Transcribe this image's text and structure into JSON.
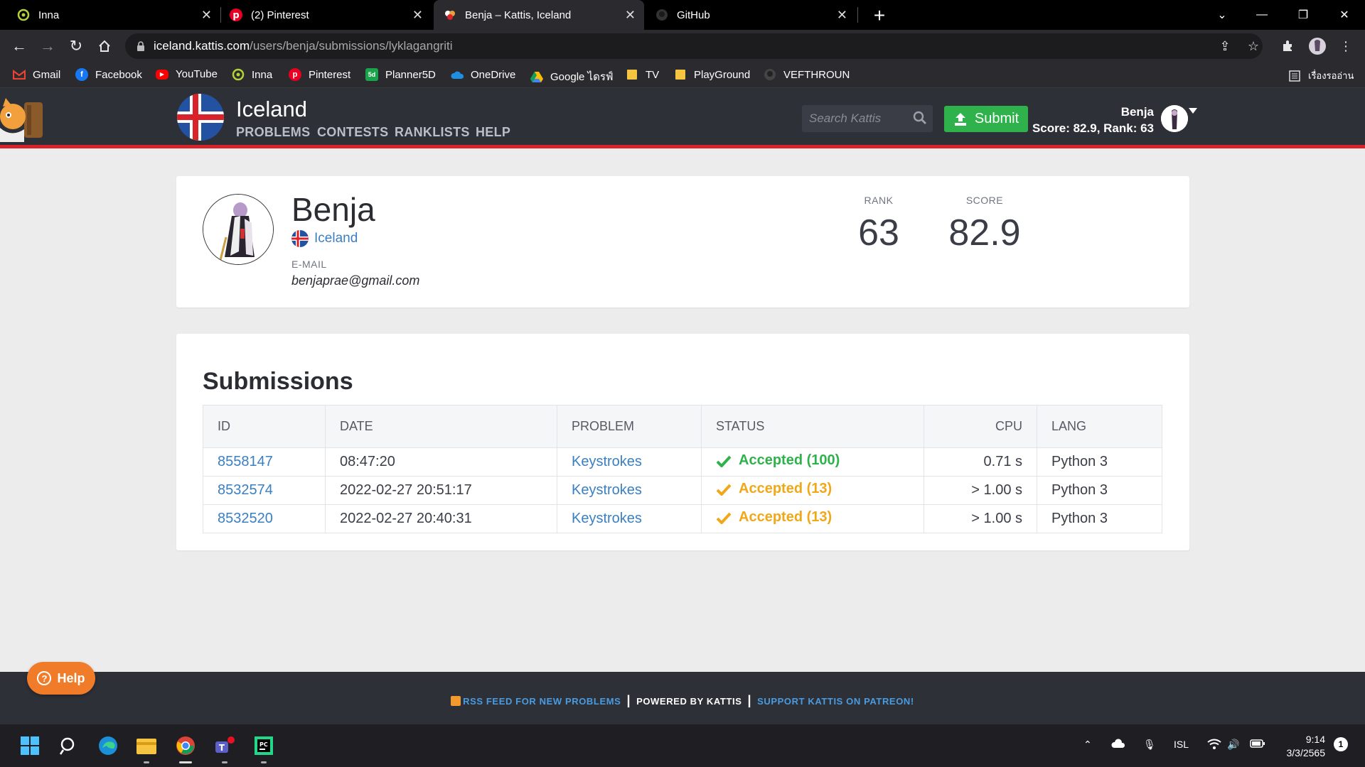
{
  "browser": {
    "tabs": [
      {
        "title": "Inna",
        "icon": "inna-icon"
      },
      {
        "title": "(2) Pinterest",
        "icon": "pinterest-icon"
      },
      {
        "title": "Benja – Kattis, Iceland",
        "icon": "kattis-icon"
      },
      {
        "title": "GitHub",
        "icon": "github-icon"
      }
    ],
    "url_host": "iceland.kattis.com",
    "url_path": "/users/benja/submissions/lyklagangriti",
    "bookmarks": [
      {
        "label": "Gmail"
      },
      {
        "label": "Facebook"
      },
      {
        "label": "YouTube"
      },
      {
        "label": "Inna"
      },
      {
        "label": "Pinterest"
      },
      {
        "label": "Planner5D"
      },
      {
        "label": "OneDrive"
      },
      {
        "label": "Google ไดรฟ์"
      },
      {
        "label": "TV"
      },
      {
        "label": "PlayGround"
      },
      {
        "label": "VEFTHROUN"
      }
    ],
    "reading_list": "เรื่องรออ่าน"
  },
  "header": {
    "brand": "Iceland",
    "nav": [
      "PROBLEMS",
      "CONTESTS",
      "RANKLISTS",
      "HELP"
    ],
    "search_placeholder": "Search Kattis",
    "submit_label": "Submit",
    "user_name": "Benja",
    "user_stats": "Score: 82.9, Rank: 63"
  },
  "profile": {
    "name": "Benja",
    "country": "Iceland",
    "email_label": "E-MAIL",
    "email": "benjaprae@gmail.com",
    "rank_label": "RANK",
    "rank": "63",
    "score_label": "SCORE",
    "score": "82.9"
  },
  "submissions": {
    "title": "Submissions",
    "columns": [
      "ID",
      "DATE",
      "PROBLEM",
      "STATUS",
      "CPU",
      "LANG"
    ],
    "rows": [
      {
        "id": "8558147",
        "date": "08:47:20",
        "problem": "Keystrokes",
        "status": "Accepted (100)",
        "status_color": "#2fb24c",
        "cpu": "0.71 s",
        "lang": "Python 3"
      },
      {
        "id": "8532574",
        "date": "2022-02-27 20:51:17",
        "problem": "Keystrokes",
        "status": "Accepted (13)",
        "status_color": "#f0a818",
        "cpu": "> 1.00 s",
        "lang": "Python 3"
      },
      {
        "id": "8532520",
        "date": "2022-02-27 20:40:31",
        "problem": "Keystrokes",
        "status": "Accepted (13)",
        "status_color": "#f0a818",
        "cpu": "> 1.00 s",
        "lang": "Python 3"
      }
    ]
  },
  "footer": {
    "rss": "RSS FEED FOR NEW PROBLEMS",
    "powered": "POWERED BY KATTIS",
    "support": "SUPPORT KATTIS ON PATREON!"
  },
  "help_button": "Help",
  "taskbar": {
    "lang": "ISL",
    "time": "9:14",
    "date": "3/3/2565",
    "notification_count": "1"
  },
  "colors": {
    "accent_link": "#3a7fc2",
    "header_bg": "#2e3038",
    "header_red": "#d8232a",
    "submit_green": "#2fb24c",
    "help_orange": "#f07c29"
  }
}
